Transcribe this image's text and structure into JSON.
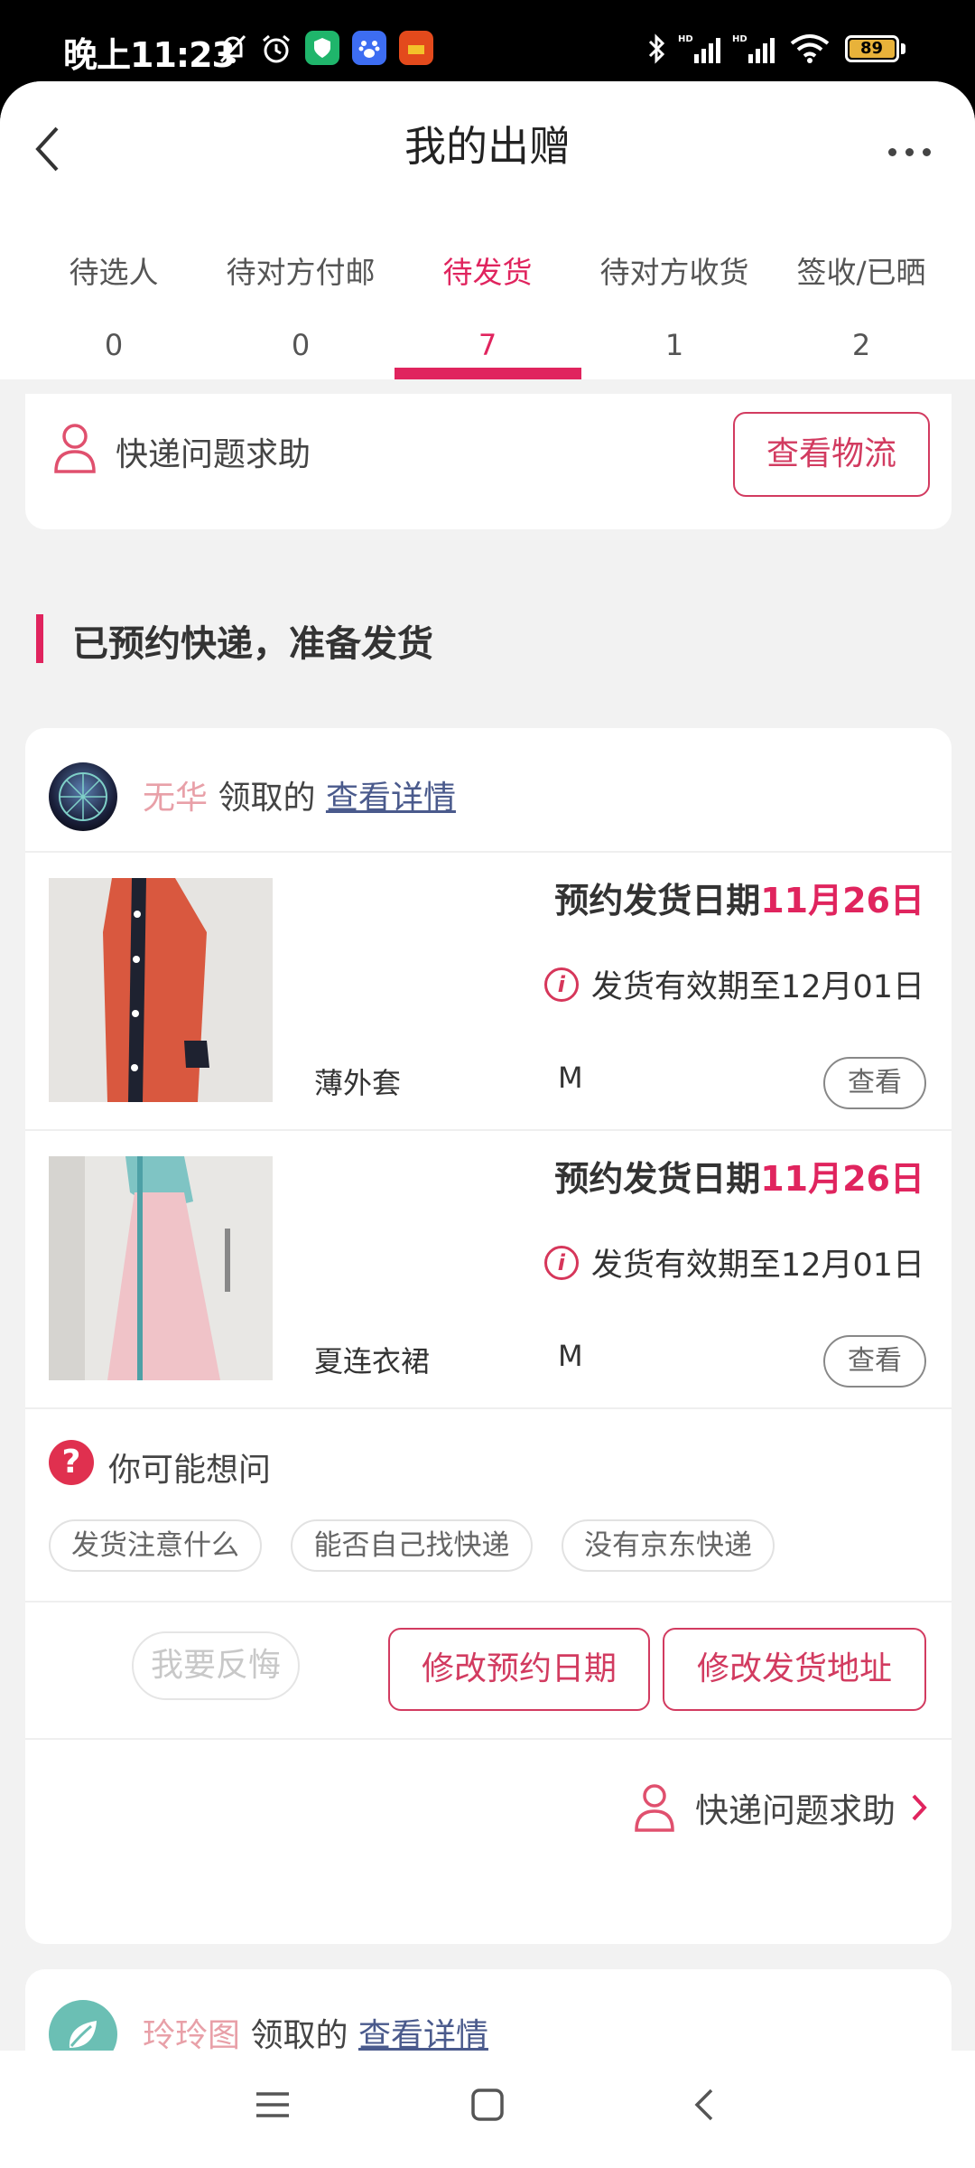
{
  "status": {
    "time": "晚上11:23",
    "battery": "89"
  },
  "header": {
    "title": "我的出赠"
  },
  "tabs": [
    {
      "label": "待选人",
      "count": "0"
    },
    {
      "label": "待对方付邮",
      "count": "0"
    },
    {
      "label": "待发货",
      "count": "7"
    },
    {
      "label": "待对方收货",
      "count": "1"
    },
    {
      "label": "签收/已晒",
      "count": "2"
    }
  ],
  "help_card": {
    "label": "快递问题求助",
    "button": "查看物流"
  },
  "section": {
    "title": "已预约快递，准备发货"
  },
  "order1": {
    "user": "无华",
    "received": "领取的",
    "detail_link": "查看详情",
    "items": [
      {
        "date_prefix": "预约发货日期",
        "date": "11月26日",
        "valid": "发货有效期至12月01日",
        "name": "薄外套",
        "size": "M",
        "view": "查看"
      },
      {
        "date_prefix": "预约发货日期",
        "date": "11月26日",
        "valid": "发货有效期至12月01日",
        "name": "夏连衣裙",
        "size": "M",
        "view": "查看"
      }
    ],
    "faq_title": "你可能想问",
    "faq_chips": [
      "发货注意什么",
      "能否自己找快递",
      "没有京东快递"
    ],
    "actions": {
      "regret": "我要反悔",
      "change_date": "修改预约日期",
      "change_address": "修改发货地址"
    },
    "help": "快递问题求助"
  },
  "order2": {
    "user": "玲玲图",
    "received": "领取的",
    "detail_link": "查看详情"
  },
  "colors": {
    "accent": "#e0245e",
    "background": "#f2f2f2"
  }
}
